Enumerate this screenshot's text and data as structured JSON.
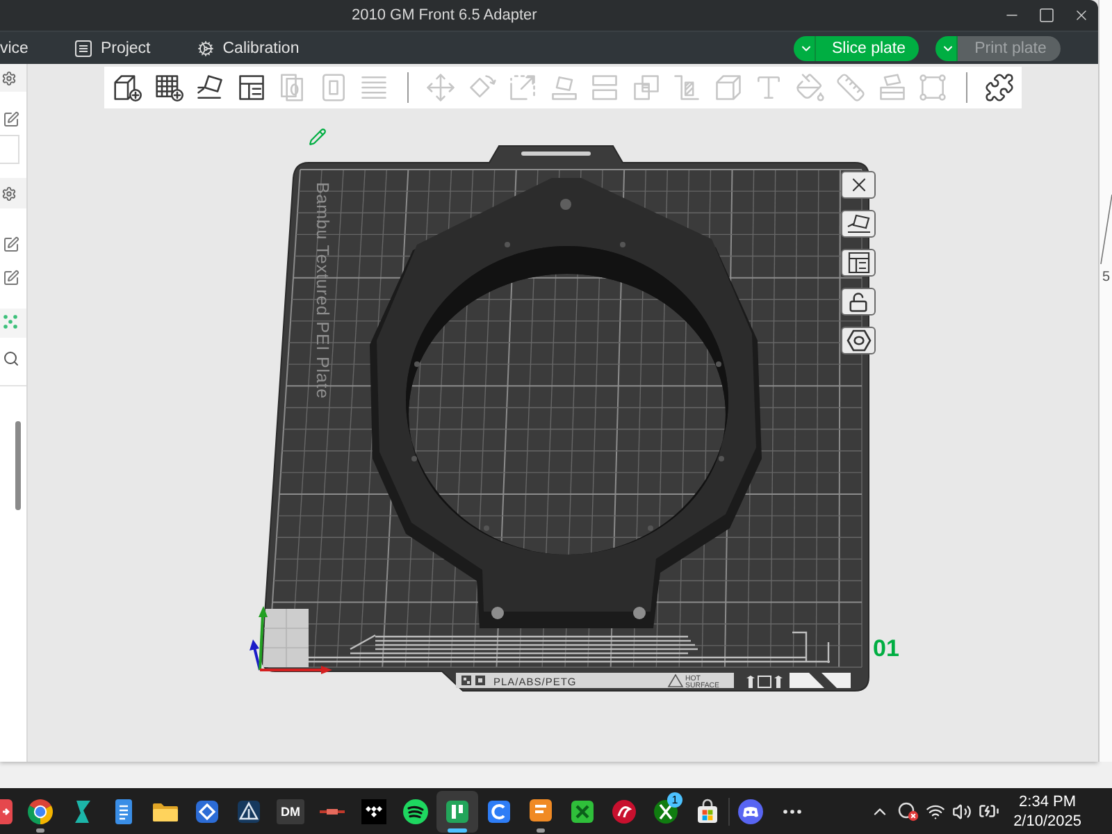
{
  "window": {
    "title": "2010 GM Front 6.5 Adapter"
  },
  "menu_tabs": [
    {
      "label": "vice"
    },
    {
      "label": "Project"
    },
    {
      "label": "Calibration"
    }
  ],
  "actions": [
    {
      "label": "Slice plate",
      "disabled": false
    },
    {
      "label": "Print plate",
      "disabled": true
    }
  ],
  "toolbar": {
    "groups": [
      {
        "tools": [
          {
            "disabled": false
          },
          {
            "disabled": false
          },
          {
            "disabled": false
          },
          {
            "disabled": false
          },
          {
            "disabled": true
          },
          {
            "disabled": true
          },
          {
            "disabled": true
          }
        ]
      },
      {
        "tools": [
          {
            "disabled": true
          },
          {
            "disabled": true
          },
          {
            "disabled": true
          },
          {
            "disabled": true
          },
          {
            "disabled": true
          },
          {
            "disabled": true
          },
          {
            "disabled": true
          },
          {
            "disabled": true
          },
          {
            "disabled": true
          },
          {
            "disabled": true
          },
          {
            "disabled": true
          },
          {
            "disabled": true
          },
          {
            "disabled": true
          }
        ]
      },
      {
        "tools": [
          {
            "disabled": false
          }
        ]
      }
    ]
  },
  "plate": {
    "name": "Bambu Textured PEI Plate",
    "number": "01",
    "material": "PLA/ABS/PETG",
    "warning": "HOT SURFACE",
    "locked": false
  },
  "background_window": {
    "text": "5"
  },
  "taskbar": {
    "apps": [
      {
        "running": false,
        "selected": false
      },
      {
        "running": true,
        "selected": false
      },
      {
        "running": false,
        "selected": false
      },
      {
        "running": false,
        "selected": false
      },
      {
        "running": false,
        "selected": false
      },
      {
        "running": false,
        "selected": false
      },
      {
        "running": false,
        "selected": false
      },
      {
        "label": "DM",
        "running": false,
        "selected": false
      },
      {
        "running": false,
        "selected": false
      },
      {
        "running": false,
        "selected": false
      },
      {
        "running": false,
        "selected": false
      },
      {
        "running": true,
        "selected": true
      },
      {
        "running": false,
        "selected": false
      },
      {
        "running": true,
        "selected": false
      },
      {
        "running": false,
        "selected": false
      },
      {
        "running": false,
        "selected": false
      },
      {
        "badge": "1",
        "running": false,
        "selected": false
      },
      {
        "running": false,
        "selected": false
      },
      {
        "running": false,
        "selected": false
      }
    ],
    "tray": {
      "time": "2:34 PM",
      "date": "2/10/2025"
    }
  }
}
